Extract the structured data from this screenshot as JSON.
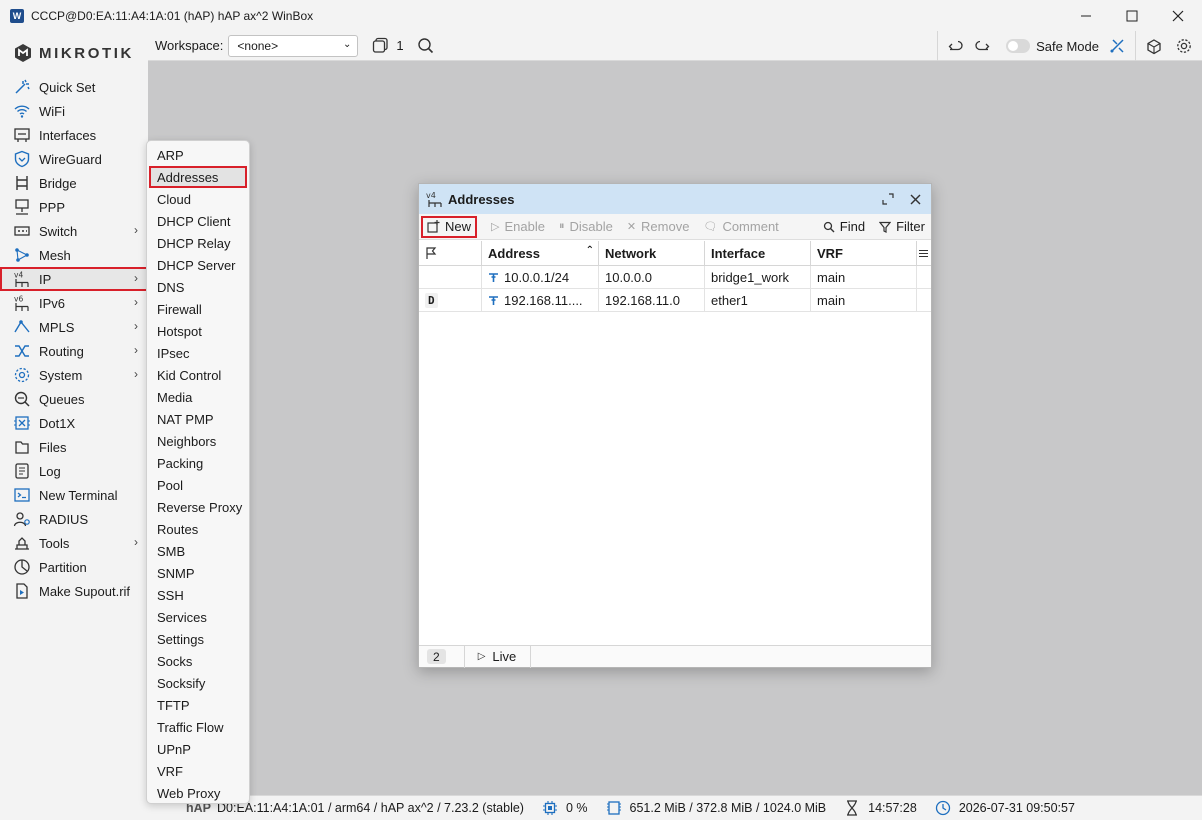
{
  "window": {
    "title": "CCCP@D0:EA:11:A4:1A:01 (hAP) hAP ax^2 WinBox",
    "minimize": "—",
    "maximize": "☐",
    "close": "✕"
  },
  "brand": {
    "logo_text": "MIKROTIK"
  },
  "sidebar": {
    "items": [
      {
        "label": "Quick Set",
        "icon": "quick-set-icon",
        "submenu": false
      },
      {
        "label": "WiFi",
        "icon": "wifi-icon",
        "submenu": false
      },
      {
        "label": "Interfaces",
        "icon": "interfaces-icon",
        "submenu": false
      },
      {
        "label": "WireGuard",
        "icon": "wireguard-icon",
        "submenu": false
      },
      {
        "label": "Bridge",
        "icon": "bridge-icon",
        "submenu": false
      },
      {
        "label": "PPP",
        "icon": "ppp-icon",
        "submenu": false
      },
      {
        "label": "Switch",
        "icon": "switch-icon",
        "submenu": true
      },
      {
        "label": "Mesh",
        "icon": "mesh-icon",
        "submenu": false
      },
      {
        "label": "IP",
        "icon": "ip-icon",
        "submenu": true,
        "selected": true
      },
      {
        "label": "IPv6",
        "icon": "ipv6-icon",
        "submenu": true
      },
      {
        "label": "MPLS",
        "icon": "mpls-icon",
        "submenu": true
      },
      {
        "label": "Routing",
        "icon": "routing-icon",
        "submenu": true
      },
      {
        "label": "System",
        "icon": "system-icon",
        "submenu": true
      },
      {
        "label": "Queues",
        "icon": "queues-icon",
        "submenu": false
      },
      {
        "label": "Dot1X",
        "icon": "dot1x-icon",
        "submenu": false
      },
      {
        "label": "Files",
        "icon": "files-icon",
        "submenu": false
      },
      {
        "label": "Log",
        "icon": "log-icon",
        "submenu": false
      },
      {
        "label": "New Terminal",
        "icon": "terminal-icon",
        "submenu": false
      },
      {
        "label": "RADIUS",
        "icon": "radius-icon",
        "submenu": false
      },
      {
        "label": "Tools",
        "icon": "tools-icon",
        "submenu": true
      },
      {
        "label": "Partition",
        "icon": "partition-icon",
        "submenu": false
      },
      {
        "label": "Make Supout.rif",
        "icon": "supout-icon",
        "submenu": false
      }
    ],
    "chevron": "›"
  },
  "toolbar": {
    "workspace_label": "Workspace:",
    "workspace_value": "<none>",
    "windows_count": "1",
    "safe_mode_label": "Safe Mode"
  },
  "ip_submenu": {
    "items": [
      "ARP",
      "Addresses",
      "Cloud",
      "DHCP Client",
      "DHCP Relay",
      "DHCP Server",
      "DNS",
      "Firewall",
      "Hotspot",
      "IPsec",
      "Kid Control",
      "Media",
      "NAT PMP",
      "Neighbors",
      "Packing",
      "Pool",
      "Reverse Proxy",
      "Routes",
      "SMB",
      "SNMP",
      "SSH",
      "Services",
      "Settings",
      "Socks",
      "Socksify",
      "TFTP",
      "Traffic Flow",
      "UPnP",
      "VRF",
      "Web Proxy"
    ],
    "selected": "Addresses"
  },
  "addresses_window": {
    "title": "Addresses",
    "toolbar": {
      "new": "New",
      "enable": "Enable",
      "disable": "Disable",
      "remove": "Remove",
      "comment": "Comment",
      "find": "Find",
      "filter": "Filter"
    },
    "columns": [
      "",
      "Address",
      "Network",
      "Interface",
      "VRF"
    ],
    "rows": [
      {
        "flag": "",
        "address": "10.0.0.1/24",
        "network": "10.0.0.0",
        "interface": "bridge1_work",
        "vrf": "main"
      },
      {
        "flag": "D",
        "address": "192.168.11....",
        "network": "192.168.11.0",
        "interface": "ether1",
        "vrf": "main"
      }
    ],
    "footer": {
      "count": "2",
      "live": "Live"
    }
  },
  "statusbar": {
    "identity_partial": "hAP",
    "info": "D0:EA:11:A4:1A:01 / arm64 / hAP ax^2 / 7.23.2 (stable)",
    "cpu": "0 %",
    "memory": "651.2 MiB / 372.8 MiB / 1024.0 MiB",
    "uptime": "14:57:28",
    "datetime": "2026-07-31 09:50:57"
  },
  "colors": {
    "accent_red": "#d8202a",
    "window_title_bg": "#cfe3f5",
    "workspace_bg": "#c8c8c9",
    "link_blue": "#1e6fbf"
  }
}
